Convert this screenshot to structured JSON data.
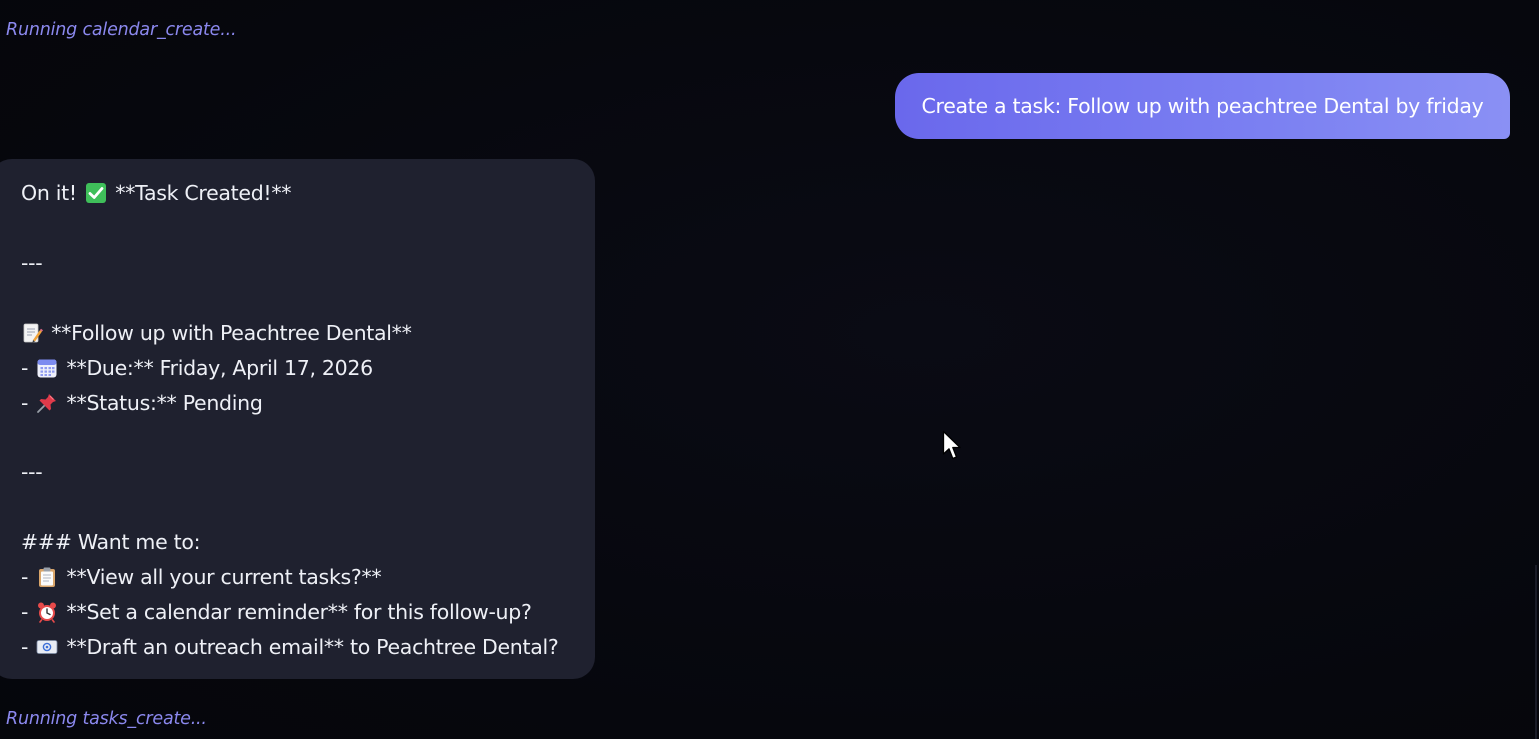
{
  "status": {
    "top": "Running calendar_create...",
    "bottom": "Running tasks_create..."
  },
  "user_message": {
    "text": "Create a task: Follow up with peachtree Dental by friday"
  },
  "assistant_message": {
    "line1_a": "On it!",
    "line1_b": "**Task Created!**",
    "separator1": "---",
    "task_title": "**Follow up with Peachtree Dental**",
    "due_prefix": "- ",
    "due_text": "**Due:** Friday, April 17, 2026",
    "status_prefix": "- ",
    "status_text": "**Status:** Pending",
    "separator2": "---",
    "want_heading": "### Want me to:",
    "option1_prefix": "- ",
    "option1_text": "**View all your current tasks?**",
    "option2_prefix": "- ",
    "option2_text": "**Set a calendar reminder** for this follow-up?",
    "option3_prefix": "- ",
    "option3_text": "**Draft an outreach email** to Peachtree Dental?"
  },
  "colors": {
    "background": "#07080f",
    "status_text": "#8b88ee",
    "user_bubble_start": "#6a68ec",
    "user_bubble_end": "#8a90f4",
    "assistant_bubble": "#1f212f",
    "text": "#eef0f6"
  },
  "icons": {
    "check": "check-mark-button-icon",
    "memo": "memo-icon",
    "calendar": "calendar-icon",
    "pin": "pushpin-icon",
    "clipboard": "clipboard-icon",
    "alarm": "alarm-clock-icon",
    "email": "envelope-icon",
    "cursor": "mouse-pointer-icon"
  }
}
